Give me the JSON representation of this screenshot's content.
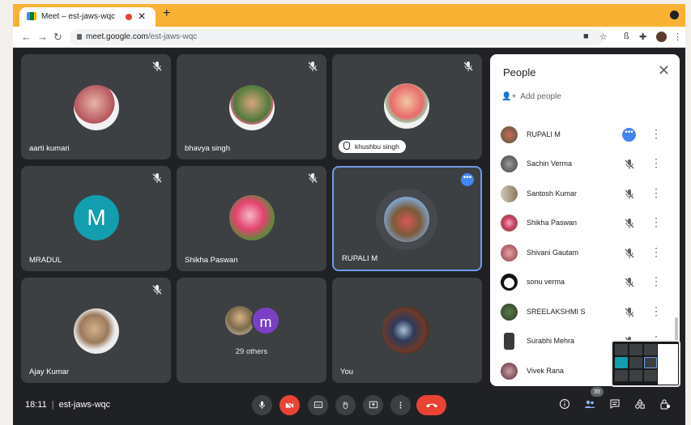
{
  "browser": {
    "tab_title": "Meet – est-jaws-wqc",
    "tab_close": "✕",
    "new_tab": "+",
    "url_host": "meet.google.com",
    "url_path": "/est-jaws-wqc"
  },
  "tiles": [
    {
      "name": "aarti kumari",
      "muted": true
    },
    {
      "name": "bhavya singh",
      "muted": true
    },
    {
      "name": "khushbu singh",
      "muted": true,
      "hand_raised": true
    },
    {
      "name": "MRADUL",
      "muted": true,
      "initial": "M"
    },
    {
      "name": "Shikha Paswan",
      "muted": true
    },
    {
      "name": "RUPALI M",
      "speaking": true,
      "options": "•••"
    },
    {
      "name": "Ajay Kumar",
      "muted": true
    },
    {
      "others_initial": "m",
      "others_label": "29 others"
    },
    {
      "name": "You"
    }
  ],
  "people_panel": {
    "title": "People",
    "close": "✕",
    "add_people": "Add people",
    "participants": [
      {
        "name": "RUPALI M",
        "status": "speaking"
      },
      {
        "name": "Sachin Verma",
        "status": "muted"
      },
      {
        "name": "Santosh Kumar",
        "status": "muted"
      },
      {
        "name": "Shikha Paswan",
        "status": "muted"
      },
      {
        "name": "Shivani Gautam",
        "status": "muted"
      },
      {
        "name": "sonu verma",
        "status": "muted"
      },
      {
        "name": "SREELAKSHMI S",
        "status": "muted"
      },
      {
        "name": "Surabhi Mehra",
        "status": "muted"
      },
      {
        "name": "Vivek Rana",
        "status": ""
      }
    ]
  },
  "bottom_bar": {
    "time": "18:11",
    "separator": "|",
    "meeting_code": "est-jaws-wqc",
    "participant_count": "35"
  },
  "colors": {
    "tab_bar": "#f9b233",
    "background": "#202124",
    "tile": "#3c4043",
    "accent_blue": "#4285f4",
    "danger_red": "#ea4335",
    "mradul_avatar": "#129eaf",
    "others_avatar": "#7b3fc4"
  }
}
